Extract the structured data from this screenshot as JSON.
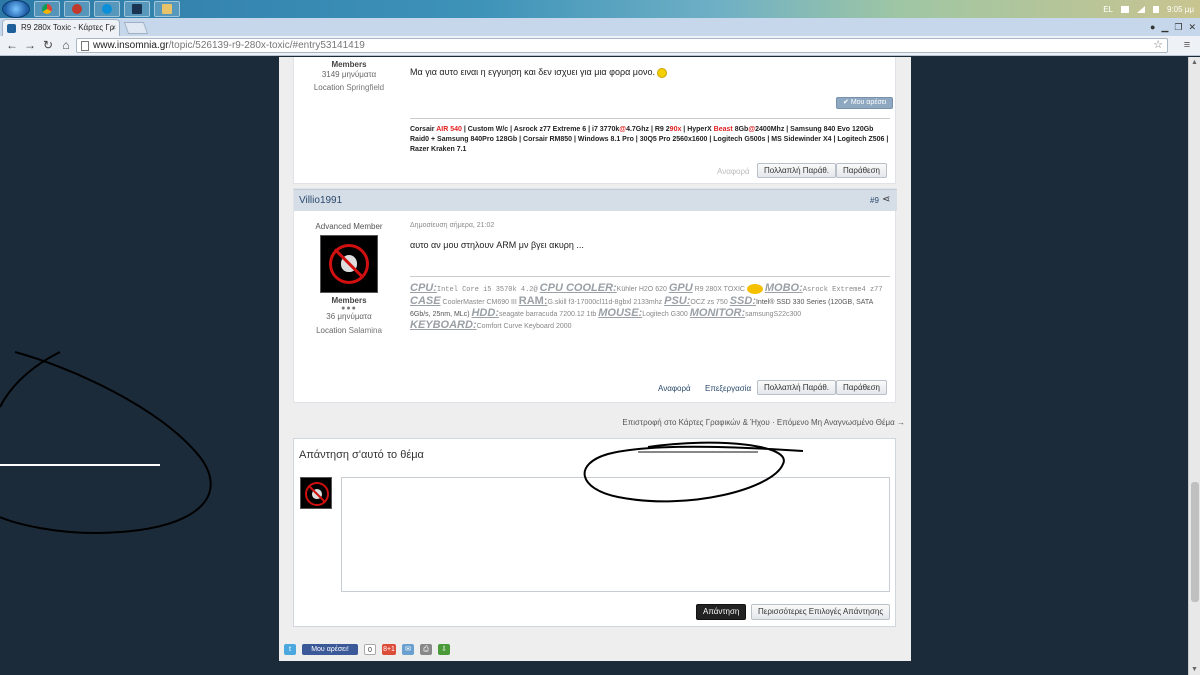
{
  "taskbar": {
    "lang": "EL",
    "clock": "9:05 μμ"
  },
  "browser": {
    "tab_title": "R9 280x Toxic - Κάρτες Γρ",
    "url_host": "www.insomnia.gr",
    "url_path": "/topic/526139-r9-280x-toxic/#entry53141419"
  },
  "post1": {
    "author_role": "Members",
    "author_posts": "3149 μηνύματα",
    "location_label": "Location",
    "location_value": "Springfield",
    "body": "Μα για αυτο ειναι η εγγυηση και δεν ισχυει για μια φορα μονο.",
    "like_button": "Μου αρέσει",
    "signature": {
      "p1": "Corsair ",
      "p2": "AIR 540",
      "p3": " | Custom W/c | Asrock z77 Extreme 6 | i7 3770k",
      "p4": "@",
      "p5": "4.7Ghz | R9 2",
      "p6": "90x",
      "p7": " | HyperX ",
      "p8": "Beast",
      "p9": " 8Gb",
      "p10": "@",
      "p11": "2400Mhz | Samsung 840 Evo 120Gb Raid0 + Samsung 840Pro 128Gb | Corsair RM850 | Windows 8.1 Pro | 30Q5 Pro 2560x1600 | Logitech G500s | MS Sidewinder X4 | Logitech Z506 | Razer Kraken 7.1"
    },
    "report_label": "Αναφορά",
    "multiquote_label": "Πολλαπλή Παράθ.",
    "quote_label": "Παράθεση"
  },
  "post2": {
    "author_name": "Villio1991",
    "post_number": "#9",
    "author_title": "Advanced Member",
    "author_role": "Members",
    "author_posts": "36 μηνύματα",
    "location_label": "Location",
    "location_value": "Salamina",
    "date": "Δημοσίευση σήμερα, 21:02",
    "body": "αυτο αν μου στηλουν ARM μν βγει ακυρη ...",
    "signature": {
      "cpu_label": "CPU:",
      "cpu_value": "Intel Core i5 3570k 4.2@",
      "cooler_label": "CPU COOLER:",
      "cooler_value": "Kühler H2O 620",
      "gpu_label": "GPU",
      "gpu_value": "R9 280X TOXIC",
      "mobo_label": "MOBO:",
      "mobo_value": "Asrock Extreme4 z77",
      "case_label": "CASE",
      "case_value": "CoolerMaster CM690 III",
      "ram_label": "RAM:",
      "ram_value": "G.skill f3-17000cl11d-8gbxl 2133mhz",
      "psu_label": "PSU:",
      "psu_value": "OCZ zs 750",
      "ssd_label": "SSD:",
      "ssd_value": "Intel® SSD 330 Series (120GB, SATA 6Gb/s, 25nm, MLc)",
      "hdd_label": "HDD:",
      "hdd_value": "seagate barracuda 7200.12 1tb",
      "mouse_label": "MOUSE:",
      "mouse_value": "Logitech G300",
      "monitor_label": "MONITOR:",
      "monitor_value": "samsungS22c300",
      "keyboard_label": "KEYBOARD:",
      "keyboard_value": "Comfort Curve Keyboard 2000"
    },
    "report_label": "Αναφορά",
    "edit_label": "Επεξεργασία",
    "multiquote_label": "Πολλαπλή Παράθ.",
    "quote_label": "Παράθεση"
  },
  "nav_links": {
    "back": "Επιστροφή στο Κάρτες Γραφικών & Ήχου",
    "sep": "·",
    "next": "Επόμενο Μη Αναγνωσμένο Θέμα →"
  },
  "reply": {
    "heading": "Απάντηση σ'αυτό το θέμα",
    "textarea_value": "",
    "submit_label": "Απάντηση",
    "more_options_label": "Περισσότερες Επιλογές Απάντησης"
  },
  "share_bar": {
    "fb_like": "Μου αρέσει!",
    "fb_count": "0",
    "gplus": "8+1"
  },
  "colors": {
    "accent_red": "#e02020",
    "page_bg": "#1c2b3a",
    "header_bar": "#d5dde7",
    "dark_button": "#222222"
  }
}
